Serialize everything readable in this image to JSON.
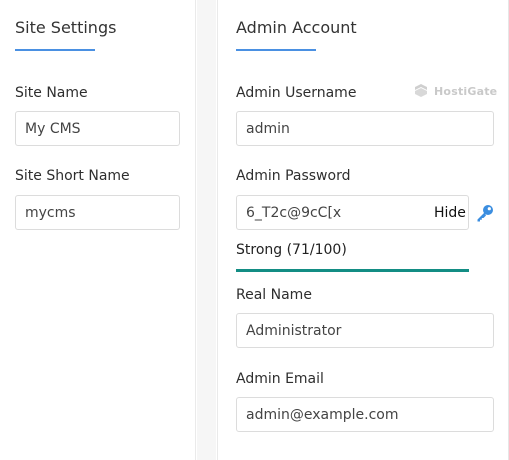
{
  "site_settings": {
    "title": "Site Settings",
    "site_name": {
      "label": "Site Name",
      "value": "My CMS"
    },
    "site_short_name": {
      "label": "Site Short Name",
      "value": "mycms"
    }
  },
  "admin_account": {
    "title": "Admin Account",
    "watermark": "HostiGate",
    "username": {
      "label": "Admin Username",
      "value": "admin"
    },
    "password": {
      "label": "Admin Password",
      "value": "6_T2c@9cC[x",
      "toggle_label": "Hide",
      "strength_text": "Strong (71/100)",
      "strength_fraction": 1.0
    },
    "real_name": {
      "label": "Real Name",
      "value": "Administrator"
    },
    "email": {
      "label": "Admin Email",
      "value": "admin@example.com"
    }
  },
  "colors": {
    "accent": "#4a90e2",
    "strength": "#138d84",
    "key_icon": "#3b8ee0"
  },
  "icons": {
    "key": "key-icon",
    "watermark_logo": "hostigate-logo-icon"
  }
}
